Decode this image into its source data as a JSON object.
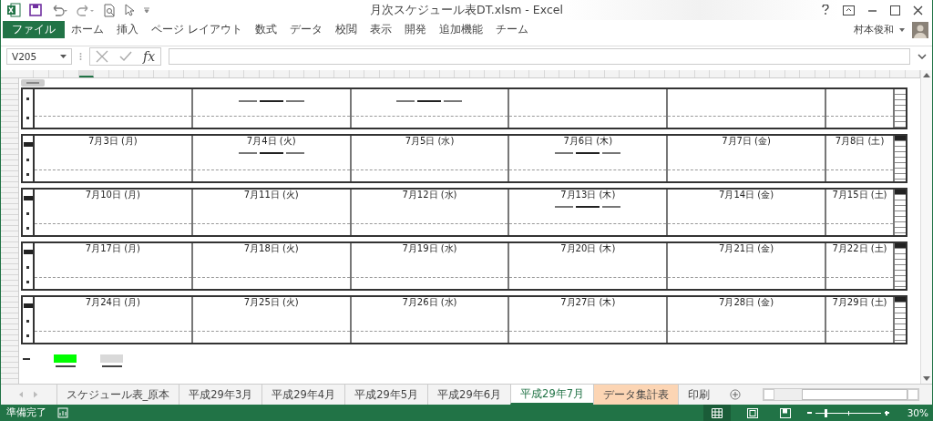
{
  "window": {
    "title": "月次スケジュール表DT.xlsm - Excel",
    "user": "村本俊和"
  },
  "ribbon_tabs": [
    {
      "label": "ファイル",
      "kind": "file"
    },
    {
      "label": "ホーム",
      "kind": "tab"
    },
    {
      "label": "挿入",
      "kind": "tab"
    },
    {
      "label": "ページ レイアウト",
      "kind": "tab"
    },
    {
      "label": "数式",
      "kind": "tab"
    },
    {
      "label": "データ",
      "kind": "tab"
    },
    {
      "label": "校閲",
      "kind": "tab"
    },
    {
      "label": "表示",
      "kind": "tab"
    },
    {
      "label": "開発",
      "kind": "tab"
    },
    {
      "label": "追加機能",
      "kind": "tab"
    },
    {
      "label": "チーム",
      "kind": "tab"
    }
  ],
  "formula_bar": {
    "name_box": "V205",
    "fx": "fx"
  },
  "weeks": [
    {
      "days": [
        {
          "has_entry": false
        },
        {
          "has_entry": true
        },
        {
          "has_entry": true
        },
        {
          "has_entry": false
        },
        {
          "has_entry": false
        },
        {
          "has_entry": false
        }
      ]
    },
    {
      "days": [
        {
          "date": "7月3日 (月)",
          "has_entry": false
        },
        {
          "date": "7月4日 (火)",
          "has_entry": true
        },
        {
          "date": "7月5日 (水)",
          "has_entry": false
        },
        {
          "date": "7月6日 (木)",
          "has_entry": true
        },
        {
          "date": "7月7日 (金)",
          "has_entry": false
        },
        {
          "date": "7月8日 (土)",
          "has_entry": false
        }
      ]
    },
    {
      "days": [
        {
          "date": "7月10日 (月)",
          "has_entry": false
        },
        {
          "date": "7月11日 (火)",
          "has_entry": false
        },
        {
          "date": "7月12日 (水)",
          "has_entry": false
        },
        {
          "date": "7月13日 (木)",
          "has_entry": true
        },
        {
          "date": "7月14日 (金)",
          "has_entry": false
        },
        {
          "date": "7月15日 (土)",
          "has_entry": false
        }
      ]
    },
    {
      "days": [
        {
          "date": "7月17日 (月)",
          "has_entry": false
        },
        {
          "date": "7月18日 (火)",
          "has_entry": false
        },
        {
          "date": "7月19日 (水)",
          "has_entry": false
        },
        {
          "date": "7月20日 (木)",
          "has_entry": false
        },
        {
          "date": "7月21日 (金)",
          "has_entry": false
        },
        {
          "date": "7月22日 (土)",
          "has_entry": false
        }
      ]
    },
    {
      "days": [
        {
          "date": "7月24日 (月)",
          "has_entry": false
        },
        {
          "date": "7月25日 (火)",
          "has_entry": false
        },
        {
          "date": "7月26日 (水)",
          "has_entry": false
        },
        {
          "date": "7月27日 (木)",
          "has_entry": false
        },
        {
          "date": "7月28日 (金)",
          "has_entry": false
        },
        {
          "date": "7月29日 (土)",
          "has_entry": false
        }
      ]
    }
  ],
  "legend": [
    {
      "color": "#00ff00"
    },
    {
      "color": "#d9d9d9"
    }
  ],
  "sheet_tabs": [
    {
      "label": "スケジュール表_原本",
      "selected": false
    },
    {
      "label": "平成29年3月",
      "selected": false
    },
    {
      "label": "平成29年4月",
      "selected": false
    },
    {
      "label": "平成29年5月",
      "selected": false
    },
    {
      "label": "平成29年6月",
      "selected": false
    },
    {
      "label": "平成29年7月",
      "selected": true
    },
    {
      "label": "データ集計表",
      "selected": false,
      "color": "#fcd5b4"
    },
    {
      "label": "印刷",
      "selected": false
    }
  ],
  "status_bar": {
    "status": "準備完了",
    "zoom": "30%",
    "zoom_level": {
      "level": 0.14
    }
  }
}
